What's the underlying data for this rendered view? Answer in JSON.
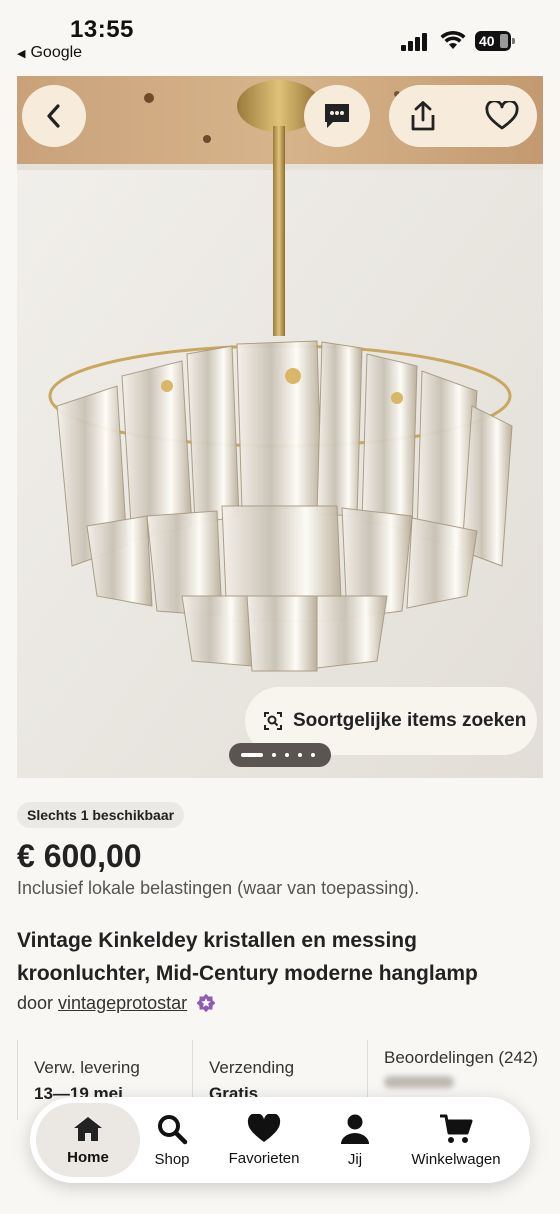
{
  "status_bar": {
    "time": "13:55",
    "back_app": "Google",
    "battery": "40"
  },
  "photo": {
    "similar_items_label": "Soortgelijke items zoeken",
    "carousel_count": 5,
    "carousel_active": 1
  },
  "listing": {
    "availability": "Slechts 1 beschikbaar",
    "price": "€ 600,00",
    "tax_note": "Inclusief lokale belastingen (waar van toepassing).",
    "title": "Vintage Kinkeldey kristallen en messing kroonluchter, Mid-Century moderne hanglamp",
    "seller_prefix": "door",
    "seller_name": "vintageprotostar"
  },
  "info_cards": [
    {
      "label": "Verw. levering",
      "value": "13—19 mei"
    },
    {
      "label": "Verzending",
      "value": "Gratis"
    },
    {
      "label": "Beoordelingen (242)"
    }
  ],
  "nav": {
    "home": "Home",
    "shop": "Shop",
    "favorites": "Favorieten",
    "me": "Jij",
    "cart": "Winkelwagen"
  },
  "colors": {
    "accent": "#7b3f9e",
    "background": "#f8f7f4",
    "button_bg": "#f7ecdc"
  }
}
